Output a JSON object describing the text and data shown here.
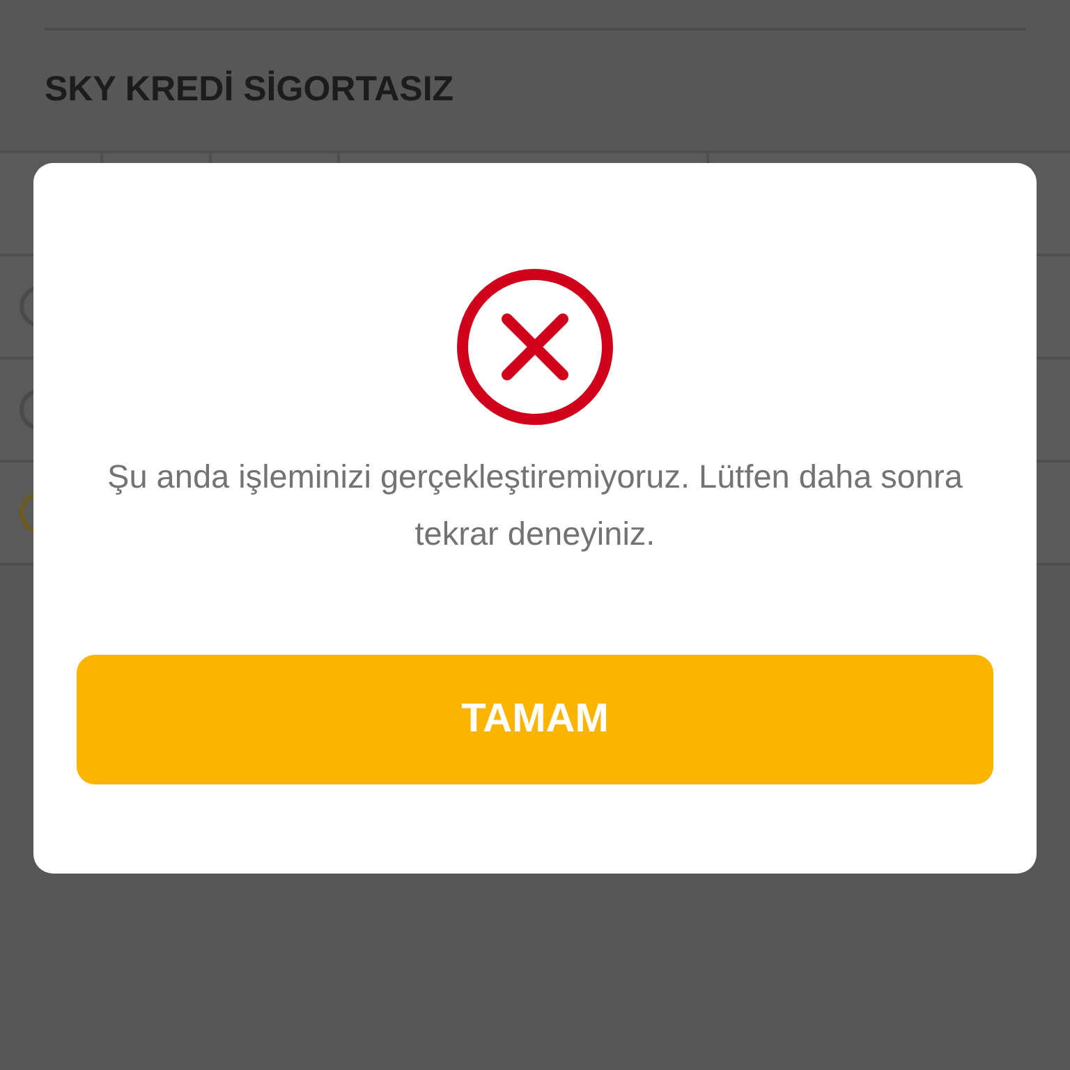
{
  "page": {
    "heading": "SKY KREDİ SİGORTASIZ",
    "rows": [
      {
        "color": "#4a4a4a"
      },
      {
        "color": "#4a4a4a"
      },
      {
        "color": "#6f5a1e"
      }
    ]
  },
  "dialog": {
    "message": "Şu anda işleminizi gerçekleştiremiyoruz. Lütfen daha sonra tekrar deneyiniz.",
    "button": "TAMAM"
  }
}
